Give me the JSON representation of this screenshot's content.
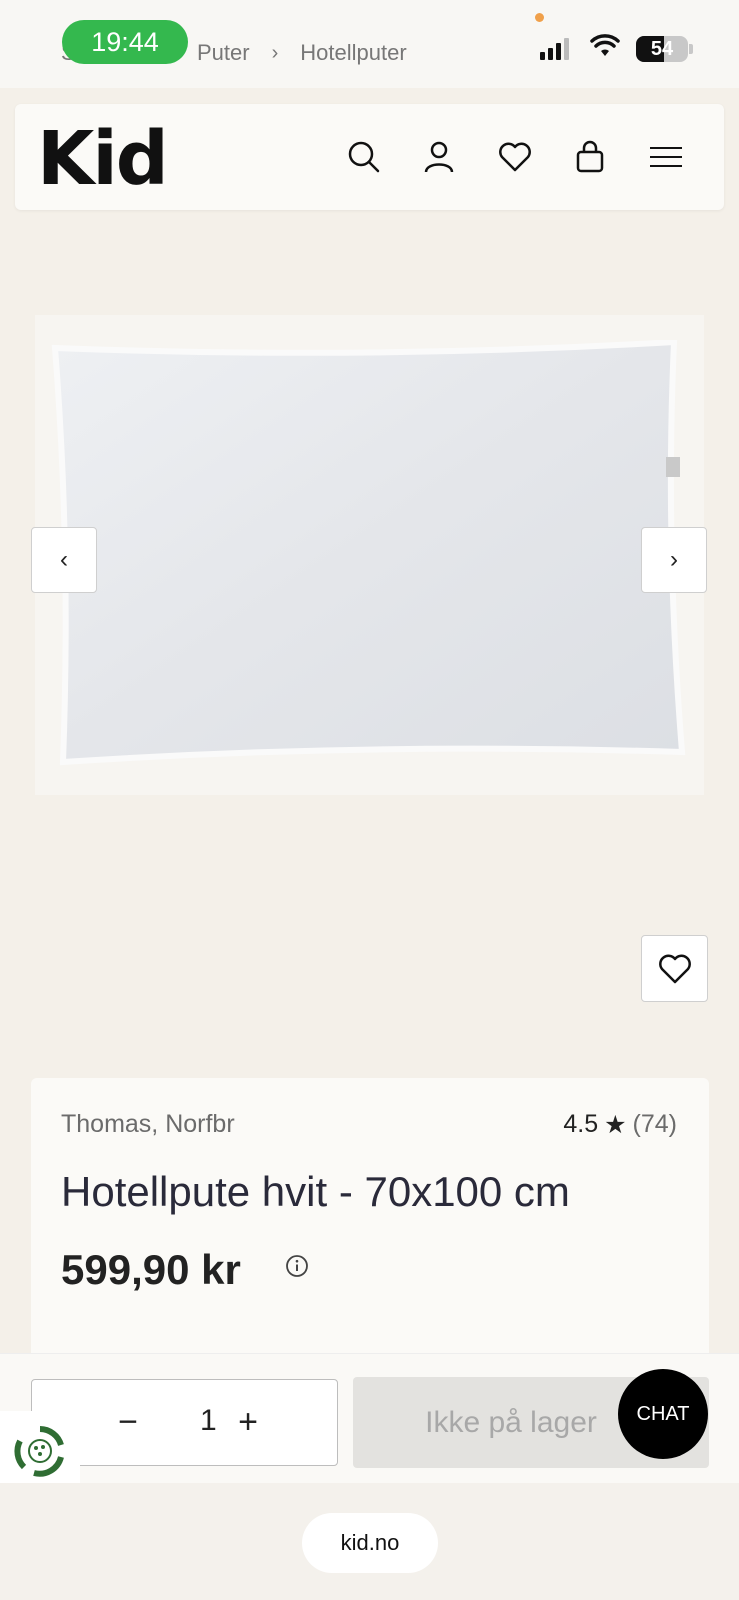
{
  "status": {
    "time": "19:44",
    "battery": "54",
    "battery_level": 0.54
  },
  "breadcrumb": {
    "partial": "S",
    "items": [
      "Puter",
      "Hotellputer"
    ]
  },
  "header": {
    "logo": "Kid",
    "icons": [
      "search-icon",
      "account-icon",
      "wishlist-icon",
      "cart-icon",
      "menu-icon"
    ]
  },
  "gallery": {
    "prev_label": "‹",
    "next_label": "›"
  },
  "product": {
    "brand": "Thomas, Norfbr",
    "rating": "4.5",
    "rating_star": "★",
    "review_count": "(74)",
    "title": "Hotellpute hvit - 70x100 cm",
    "price": "599,90 kr"
  },
  "purchase": {
    "minus": "−",
    "quantity": "1",
    "plus": "+",
    "button_label": "Ikke på lager"
  },
  "chat": {
    "label": "CHAT"
  },
  "browser": {
    "url": "kid.no"
  }
}
